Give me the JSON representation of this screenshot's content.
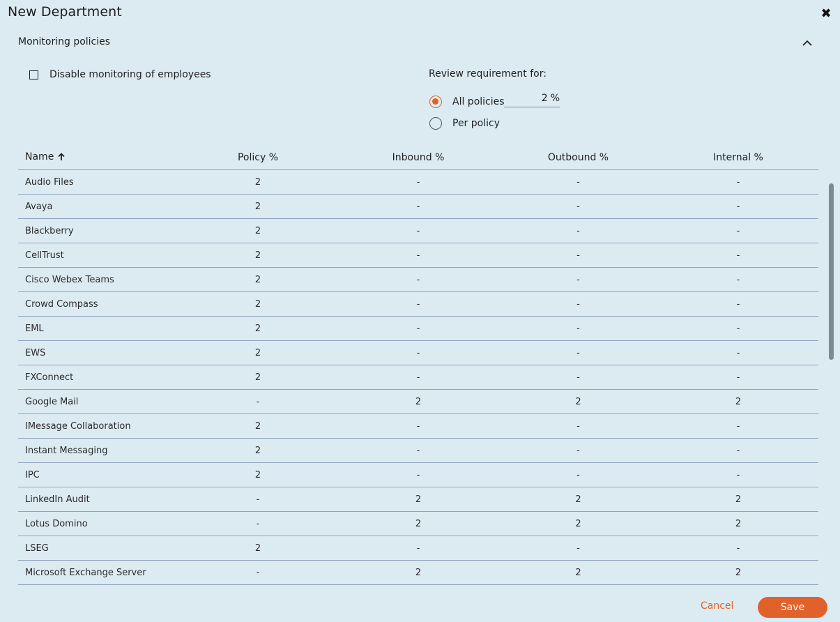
{
  "dialog": {
    "title": "New Department",
    "close_icon": "close-icon"
  },
  "section": {
    "title": "Monitoring policies",
    "collapse_icon": "chevron-up-icon"
  },
  "options": {
    "disable_monitoring_label": "Disable monitoring of employees",
    "disable_monitoring_checked": false,
    "review_requirement_label": "Review requirement for:",
    "all_policies_label": "All policies",
    "per_policy_label": "Per policy",
    "selected": "All policies",
    "percent_value": "2",
    "percent_suffix": "%"
  },
  "table": {
    "columns": [
      "Name",
      "Policy %",
      "Inbound %",
      "Outbound %",
      "Internal %"
    ],
    "sort_column": "Name",
    "sort_direction_icon": "arrow-up-icon",
    "rows": [
      {
        "name": "Audio Files",
        "policy": "2",
        "inbound": "-",
        "outbound": "-",
        "internal": "-"
      },
      {
        "name": "Avaya",
        "policy": "2",
        "inbound": "-",
        "outbound": "-",
        "internal": "-"
      },
      {
        "name": "Blackberry",
        "policy": "2",
        "inbound": "-",
        "outbound": "-",
        "internal": "-"
      },
      {
        "name": "CellTrust",
        "policy": "2",
        "inbound": "-",
        "outbound": "-",
        "internal": "-"
      },
      {
        "name": "Cisco Webex Teams",
        "policy": "2",
        "inbound": "-",
        "outbound": "-",
        "internal": "-"
      },
      {
        "name": "Crowd Compass",
        "policy": "2",
        "inbound": "-",
        "outbound": "-",
        "internal": "-"
      },
      {
        "name": "EML",
        "policy": "2",
        "inbound": "-",
        "outbound": "-",
        "internal": "-"
      },
      {
        "name": "EWS",
        "policy": "2",
        "inbound": "-",
        "outbound": "-",
        "internal": "-"
      },
      {
        "name": "FXConnect",
        "policy": "2",
        "inbound": "-",
        "outbound": "-",
        "internal": "-"
      },
      {
        "name": "Google Mail",
        "policy": "-",
        "inbound": "2",
        "outbound": "2",
        "internal": "2"
      },
      {
        "name": "IMessage Collaboration",
        "policy": "2",
        "inbound": "-",
        "outbound": "-",
        "internal": "-"
      },
      {
        "name": "Instant Messaging",
        "policy": "2",
        "inbound": "-",
        "outbound": "-",
        "internal": "-"
      },
      {
        "name": "IPC",
        "policy": "2",
        "inbound": "-",
        "outbound": "-",
        "internal": "-"
      },
      {
        "name": "LinkedIn Audit",
        "policy": "-",
        "inbound": "2",
        "outbound": "2",
        "internal": "2"
      },
      {
        "name": "Lotus Domino",
        "policy": "-",
        "inbound": "2",
        "outbound": "2",
        "internal": "2"
      },
      {
        "name": "LSEG",
        "policy": "2",
        "inbound": "-",
        "outbound": "-",
        "internal": "-"
      },
      {
        "name": "Microsoft Exchange Server",
        "policy": "-",
        "inbound": "2",
        "outbound": "2",
        "internal": "2"
      }
    ]
  },
  "footer": {
    "cancel_label": "Cancel",
    "save_label": "Save"
  },
  "colors": {
    "accent": "#e0622a",
    "background": "#dcebf2",
    "row_divider": "#8fa0c0"
  }
}
